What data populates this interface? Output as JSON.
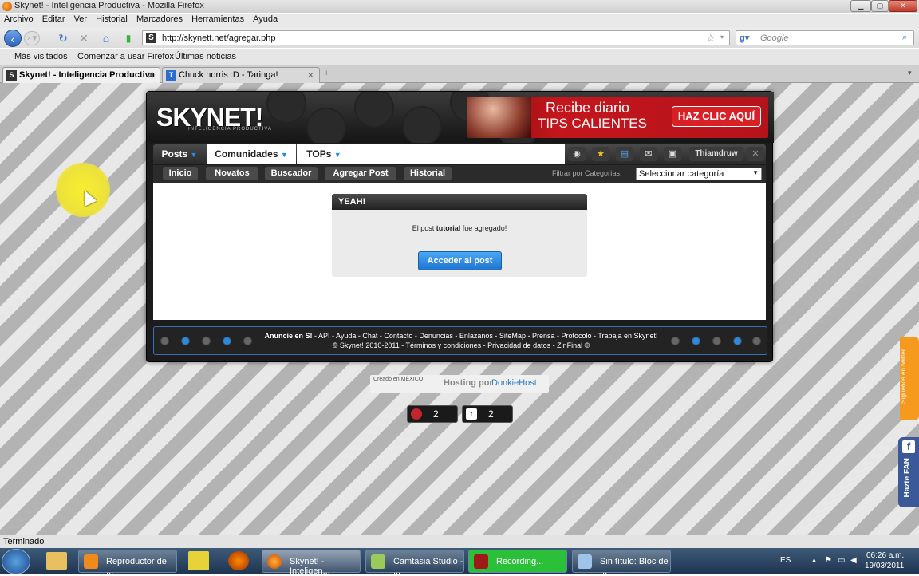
{
  "window": {
    "title": "Skynet! - Inteligencia Productiva - Mozilla Firefox"
  },
  "menu": [
    "Archivo",
    "Editar",
    "Ver",
    "Historial",
    "Marcadores",
    "Herramientas",
    "Ayuda"
  ],
  "nav": {
    "url": "http://skynett.net/agregar.php",
    "search_placeholder": "Google"
  },
  "bookmarks": [
    "Más visitados",
    "Comenzar a usar Firefox",
    "Últimas noticias"
  ],
  "tabs": [
    {
      "label": "Skynet! - Inteligencia Productiva",
      "icon": "S"
    },
    {
      "label": "Chuck norris :D - Taringa!",
      "icon": "T"
    }
  ],
  "site": {
    "logo": "SKYNET!",
    "logo_sub": "INTELIGENCIA PRODUCTIVA",
    "ad": {
      "line1": "Recibe diario",
      "line2": "TIPS CALIENTES",
      "cta": "HAZ CLIC AQUÍ"
    },
    "main_tabs": [
      "Posts",
      "Comunidades",
      "TOPs"
    ],
    "user": "Thiamdruw",
    "sub_tabs": [
      "Inicio",
      "Novatos",
      "Buscador",
      "Agregar Post",
      "Historial"
    ],
    "filter_label": "Filtrar por Categorías:",
    "category_selected": "Seleccionar categoría",
    "message": {
      "title": "YEAH!",
      "pre": "El post ",
      "bold": "tutorial",
      "post": " fue agregado!",
      "button": "Acceder al post"
    },
    "footer": {
      "line1_bold": "Anuncie en S!",
      "line1": " - API - Ayuda - Chat - Contacto - Denuncias - Enlazanos - SiteMap - Prensa - Protocolo - Trabaja en Skynet!",
      "line2": "© Skynet! 2010-2011 - Términos y condiciones - Privacidad de datos - ZinFinal ©"
    },
    "hosting": {
      "mexico": "Creado en MÉXICO",
      "label": "Hosting por",
      "brand": "DonkieHost"
    },
    "counters": [
      {
        "value": "2"
      },
      {
        "value": "2"
      }
    ],
    "twitter_side": "Síguenos en twitter",
    "fb_side": "Hazte FAN"
  },
  "status": "Terminado",
  "taskbar": {
    "items": [
      "Reproductor de ...",
      "Skynet! - Inteligen...",
      "Camtasia Studio - ...",
      "Recording...",
      "Sin título: Bloc de ..."
    ],
    "lang": "ES",
    "time": "06:26 a.m.",
    "date": "19/03/2011"
  },
  "colors": {
    "accent": "#2a8ae0",
    "recording": "#2bbf3a"
  }
}
